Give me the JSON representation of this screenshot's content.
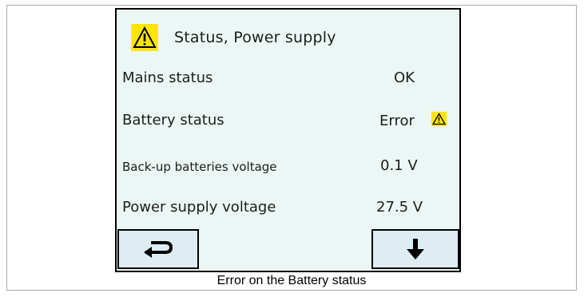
{
  "screen": {
    "title": "Status, Power supply",
    "title_icon": "warning-icon",
    "rows": [
      {
        "label": "Mains status",
        "value": "OK"
      },
      {
        "label": "Battery status",
        "value": "Error",
        "status_icon": "warning-icon"
      },
      {
        "label": "Back-up batteries voltage",
        "value": "0.1 V"
      },
      {
        "label": "Power supply voltage",
        "value": "27.5 V"
      }
    ],
    "buttons": {
      "back_icon": "return-arrow-icon",
      "down_icon": "down-arrow-icon"
    }
  },
  "caption": "Error on the Battery status",
  "colors": {
    "screen_background": "#ecf7f5",
    "button_background": "#ddedf2",
    "warning_yellow": "#ffe600"
  }
}
